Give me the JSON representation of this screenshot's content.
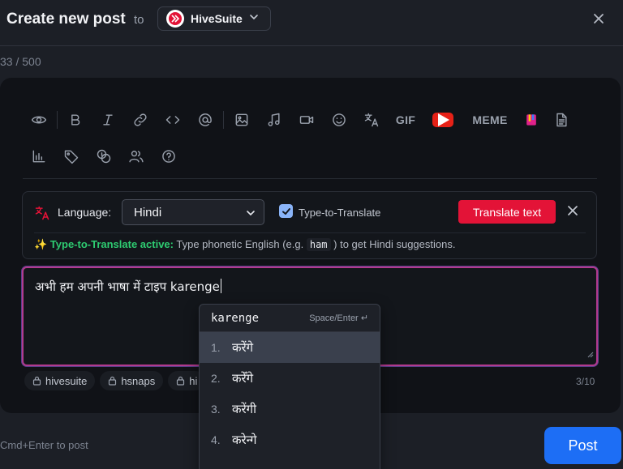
{
  "header": {
    "title": "Create new post",
    "to_word": "to",
    "community_name": "HiveSuite",
    "close_label": "Close"
  },
  "counter": "33 / 500",
  "toolbar": {
    "row1": [
      "eye-icon",
      "bold-icon",
      "italic-icon",
      "link-icon",
      "code-icon",
      "mention-icon",
      "image-icon",
      "audio-icon",
      "video-icon",
      "emoji-icon",
      "translate-icon",
      "gif",
      "youtube-icon",
      "meme",
      "hive-snaps-icon",
      "document-icon"
    ],
    "gif_label": "GIF",
    "meme_label": "MEME",
    "row2": [
      "poll-icon",
      "tag-icon",
      "coins-icon",
      "users-icon",
      "help-icon"
    ]
  },
  "language_panel": {
    "label": "Language:",
    "selected": "Hindi",
    "type_to_translate_label": "Type-to-Translate",
    "type_to_translate_checked": true,
    "translate_button": "Translate text",
    "status_prefix": "✨ Type-to-Translate active:",
    "status_text_1": "Type phonetic English (e.g.",
    "status_example": "ham",
    "status_text_2": ") to get Hindi suggestions."
  },
  "editor": {
    "text": "अभी हम अपनी भाषा में टाइप karenge"
  },
  "tags": [
    {
      "label": "hivesuite"
    },
    {
      "label": "hsnaps"
    },
    {
      "label": "hi"
    }
  ],
  "tag_count": "3/10",
  "suggestions": {
    "query": "karenge",
    "hint": "Space/Enter ↵",
    "items": [
      {
        "num": "1.",
        "word": "करेंगे"
      },
      {
        "num": "2.",
        "word": "करेँगे"
      },
      {
        "num": "3.",
        "word": "करेंगी"
      },
      {
        "num": "4.",
        "word": "करेन्गे"
      }
    ]
  },
  "footer": {
    "hint": "Cmd+Enter to post",
    "post_button": "Post"
  },
  "colors": {
    "brand_red": "#e31337",
    "accent_blue": "#1d6ef5",
    "active_green": "#2ecc71"
  }
}
